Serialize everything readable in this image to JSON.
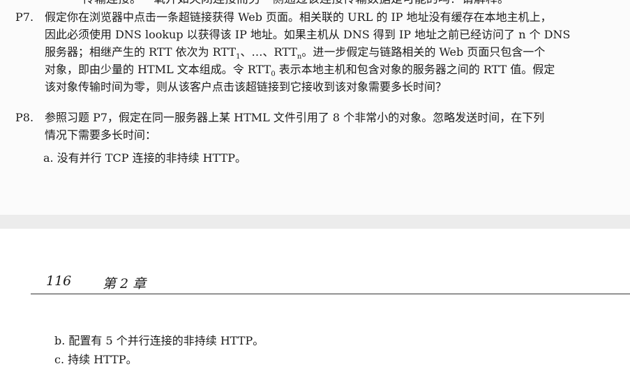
{
  "top_page": {
    "cutoff_text": "传输连接。一氧开如央闭连接而另一侧通过该连接传输数据是可能的吗？请解释。",
    "p7": {
      "number": "P7.",
      "line1": "假定你在浏览器中点击一条超链接获得 Web 页面。相关联的 URL 的 IP 地址没有缓存在本地主机上，",
      "line2": "因此必须使用 DNS lookup 以获得该 IP 地址。如果主机从 DNS 得到 IP 地址之前已经访问了 n 个 DNS",
      "line3_a": "服务器；相继产生的 RTT 依次为 RTT",
      "line3_sub1": "1",
      "line3_b": "、…、RTT",
      "line3_sub2": "n",
      "line3_c": "。进一步假定与链路相关的 Web 页面只包含一个",
      "line4_a": "对象，即由少量的 HTML 文本组成。令 RTT",
      "line4_sub": "0",
      "line4_b": " 表示本地主机和包含对象的服务器之间的 RTT 值。假定",
      "line5": "该对象传输时间为零，则从该客户点击该超链接到它接收到该对象需要多长时间？"
    },
    "p8": {
      "number": "P8.",
      "line1": "参照习题 P7，假定在同一服务器上某 HTML 文件引用了 8 个非常小的对象。忽略发送时间，在下列",
      "line2": "情况下需要多长时间：",
      "item_a": "a. 没有并行 TCP 连接的非持续 HTTP。"
    }
  },
  "bottom_page": {
    "page_number": "116",
    "chapter_label": "第 2 章",
    "item_b": "b. 配置有 5 个并行连接的非持续 HTTP。",
    "item_c": "c. 持续 HTTP。"
  }
}
